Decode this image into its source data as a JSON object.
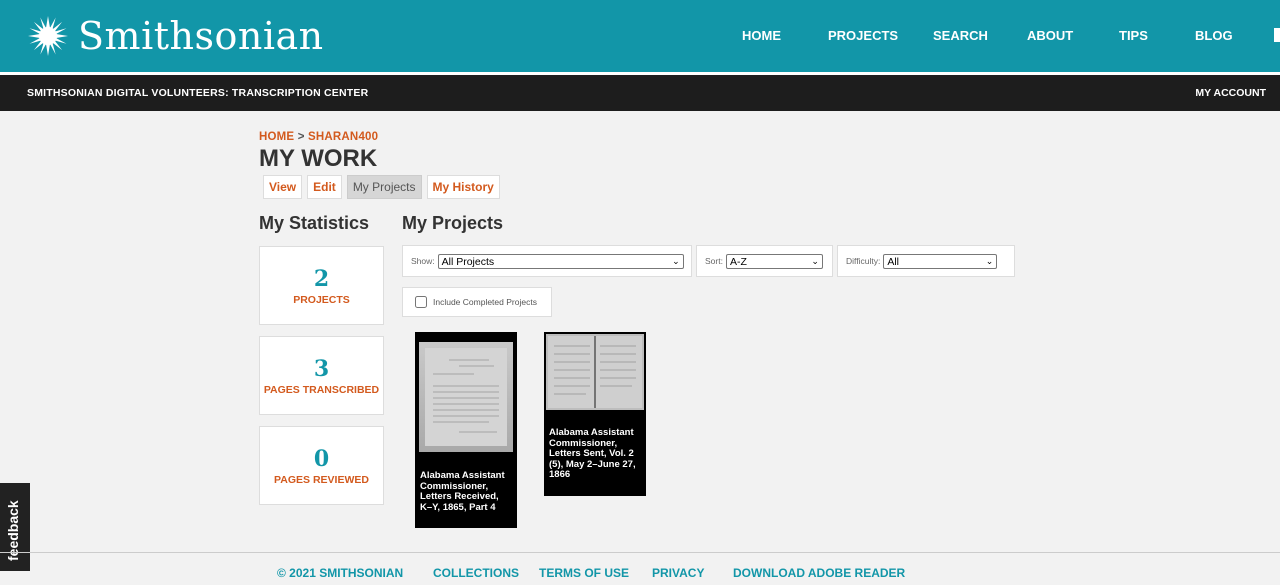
{
  "header": {
    "logo_text": "Smithsonian",
    "nav": [
      "HOME",
      "PROJECTS",
      "SEARCH",
      "ABOUT",
      "TIPS",
      "BLOG"
    ],
    "colors": {
      "header_bg": "#1296a8",
      "accent_orange": "#d35a1e",
      "teal": "#1296a8"
    }
  },
  "subheader": {
    "site_title": "SMITHSONIAN DIGITAL VOLUNTEERS: TRANSCRIPTION CENTER",
    "account_link": "MY ACCOUNT"
  },
  "breadcrumb": {
    "home": "HOME",
    "separator": ">",
    "user": "SHARAN400"
  },
  "page_title": "MY WORK",
  "tabs": [
    {
      "label": "View",
      "active": false
    },
    {
      "label": "Edit",
      "active": false
    },
    {
      "label": "My Projects",
      "active": true
    },
    {
      "label": "My History",
      "active": false
    }
  ],
  "statistics": {
    "heading": "My Statistics",
    "items": [
      {
        "value": "2",
        "label": "PROJECTS"
      },
      {
        "value": "3",
        "label": "PAGES TRANSCRIBED"
      },
      {
        "value": "0",
        "label": "PAGES REVIEWED"
      }
    ]
  },
  "projects": {
    "heading": "My Projects",
    "filters": {
      "show": {
        "label": "Show:",
        "value": "All Projects"
      },
      "sort": {
        "label": "Sort:",
        "value": "A-Z"
      },
      "difficulty": {
        "label": "Difficulty:",
        "value": "All"
      }
    },
    "include_completed_label": "Include Completed Projects",
    "cards": [
      {
        "title": "Alabama Assistant Commissioner, Letters Received, K–Y, 1865, Part 4"
      },
      {
        "title": "Alabama Assistant Commissioner, Letters Sent, Vol. 2 (5), May 2–June 27, 1866"
      }
    ]
  },
  "feedback_label": "feedback",
  "footer": {
    "links": [
      "© 2021 SMITHSONIAN",
      "COLLECTIONS",
      "TERMS OF USE",
      "PRIVACY",
      "DOWNLOAD ADOBE READER"
    ]
  }
}
